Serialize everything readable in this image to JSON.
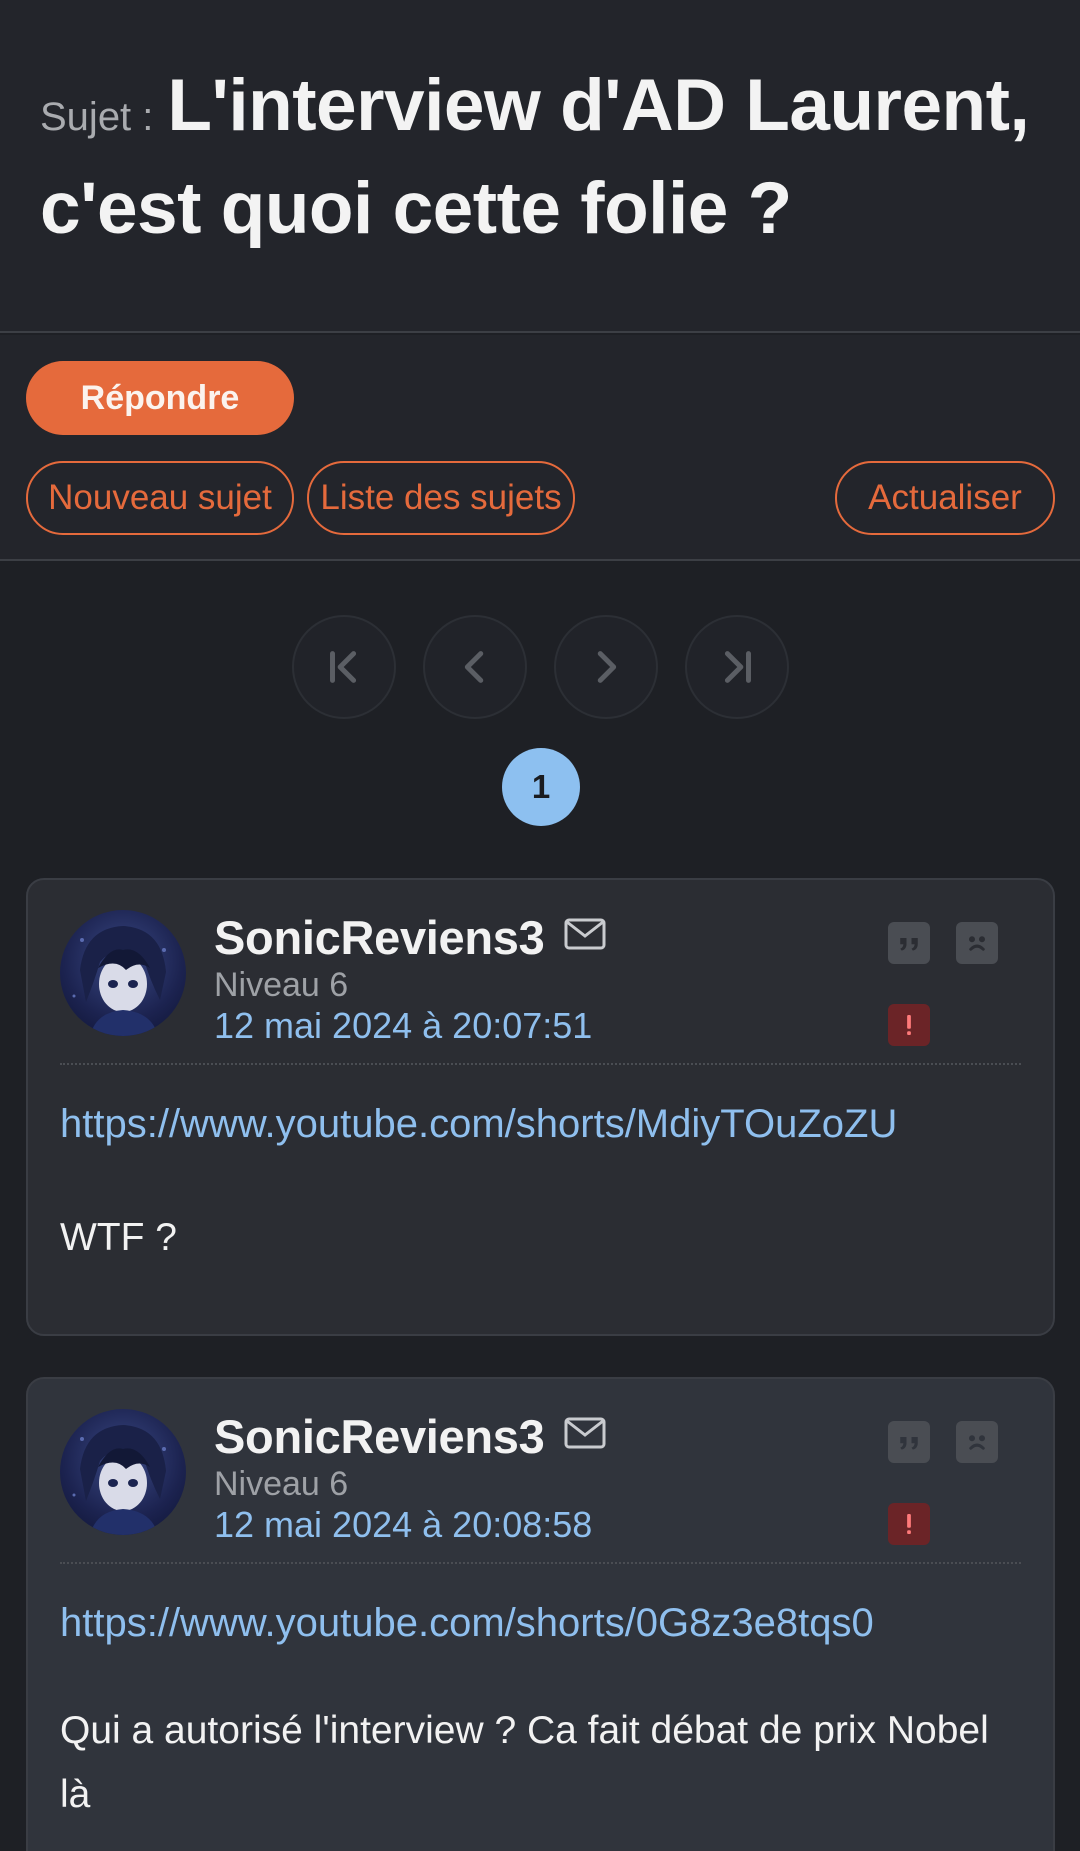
{
  "topic": {
    "prefix": "Sujet :",
    "title": "L'interview d'AD Laurent, c'est quoi cette folie ?"
  },
  "actions": {
    "reply_label": "Répondre",
    "new_topic_label": "Nouveau sujet",
    "topic_list_label": "Liste des sujets",
    "refresh_label": "Actualiser"
  },
  "pagination": {
    "current_page": "1",
    "buttons": [
      "first-page",
      "previous-page",
      "next-page",
      "last-page"
    ]
  },
  "posts": [
    {
      "author": "SonicReviens3",
      "level": "Niveau 6",
      "date": "12 mai 2024 à 20:07:51",
      "link": "https://www.youtube.com/shorts/MdiyTOuZoZU",
      "text": "WTF ?"
    },
    {
      "author": "SonicReviens3",
      "level": "Niveau 6",
      "date": "12 mai 2024 à 20:08:58",
      "link": "https://www.youtube.com/shorts/0G8z3e8tqs0",
      "text": "Qui a autorisé l'interview ? Ca fait débat de prix Nobel là"
    }
  ],
  "colors": {
    "accent": "#e56a3c",
    "link": "#8fbfee",
    "alert": "#6b2427",
    "background": "#1e2025"
  },
  "icons": [
    "mail-icon",
    "quote-icon",
    "sad-face-icon",
    "alert-icon",
    "first-page-icon",
    "prev-page-icon",
    "next-page-icon",
    "last-page-icon"
  ]
}
